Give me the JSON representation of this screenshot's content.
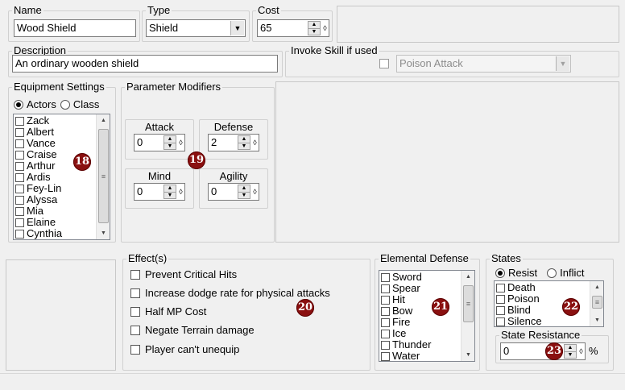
{
  "fields": {
    "name_legend": "Name",
    "name_value": "Wood Shield",
    "type_legend": "Type",
    "type_value": "Shield",
    "cost_legend": "Cost",
    "cost_value": "65",
    "description_legend": "Description",
    "description_value": "An ordinary wooden shield",
    "invoke_legend": "Invoke Skill if used",
    "invoke_value": "Poison Attack",
    "invoke_checked": false
  },
  "equipment": {
    "legend": "Equipment Settings",
    "radio_actors": "Actors",
    "radio_class": "Class",
    "selected_radio": "Actors",
    "actors": [
      "Zack",
      "Albert",
      "Vance",
      "Craise",
      "Arthur",
      "Ardis",
      "Fey-Lin",
      "Alyssa",
      "Mia",
      "Elaine",
      "Cynthia"
    ]
  },
  "params": {
    "legend": "Parameter Modifiers",
    "attack_label": "Attack",
    "attack_value": "0",
    "defense_label": "Defense",
    "defense_value": "2",
    "mind_label": "Mind",
    "mind_value": "0",
    "agility_label": "Agility",
    "agility_value": "0"
  },
  "effects": {
    "legend": "Effect(s)",
    "items": [
      "Prevent Critical Hits",
      "Increase dodge rate for physical attacks",
      "Half MP Cost",
      "Negate Terrain damage",
      "Player can't unequip"
    ]
  },
  "elemental": {
    "legend": "Elemental Defense",
    "items": [
      "Sword",
      "Spear",
      "Hit",
      "Bow",
      "Fire",
      "Ice",
      "Thunder",
      "Water"
    ]
  },
  "states": {
    "legend": "States",
    "radio_resist": "Resist",
    "radio_inflict": "Inflict",
    "selected_radio": "Resist",
    "items": [
      "Death",
      "Poison",
      "Blind",
      "Silence"
    ],
    "resistance_legend": "State Resistance",
    "resistance_value": "0",
    "percent": "%"
  },
  "badges": {
    "b18": "18",
    "b19": "19",
    "b20": "20",
    "b21": "21",
    "b22": "22",
    "b23": "23"
  },
  "icons": {
    "spin": "spin-up-down",
    "combo": "chevron-down",
    "check": "checkbox-empty"
  },
  "colors": {
    "badge": "#8a1010",
    "background": "#f0f0f0"
  }
}
